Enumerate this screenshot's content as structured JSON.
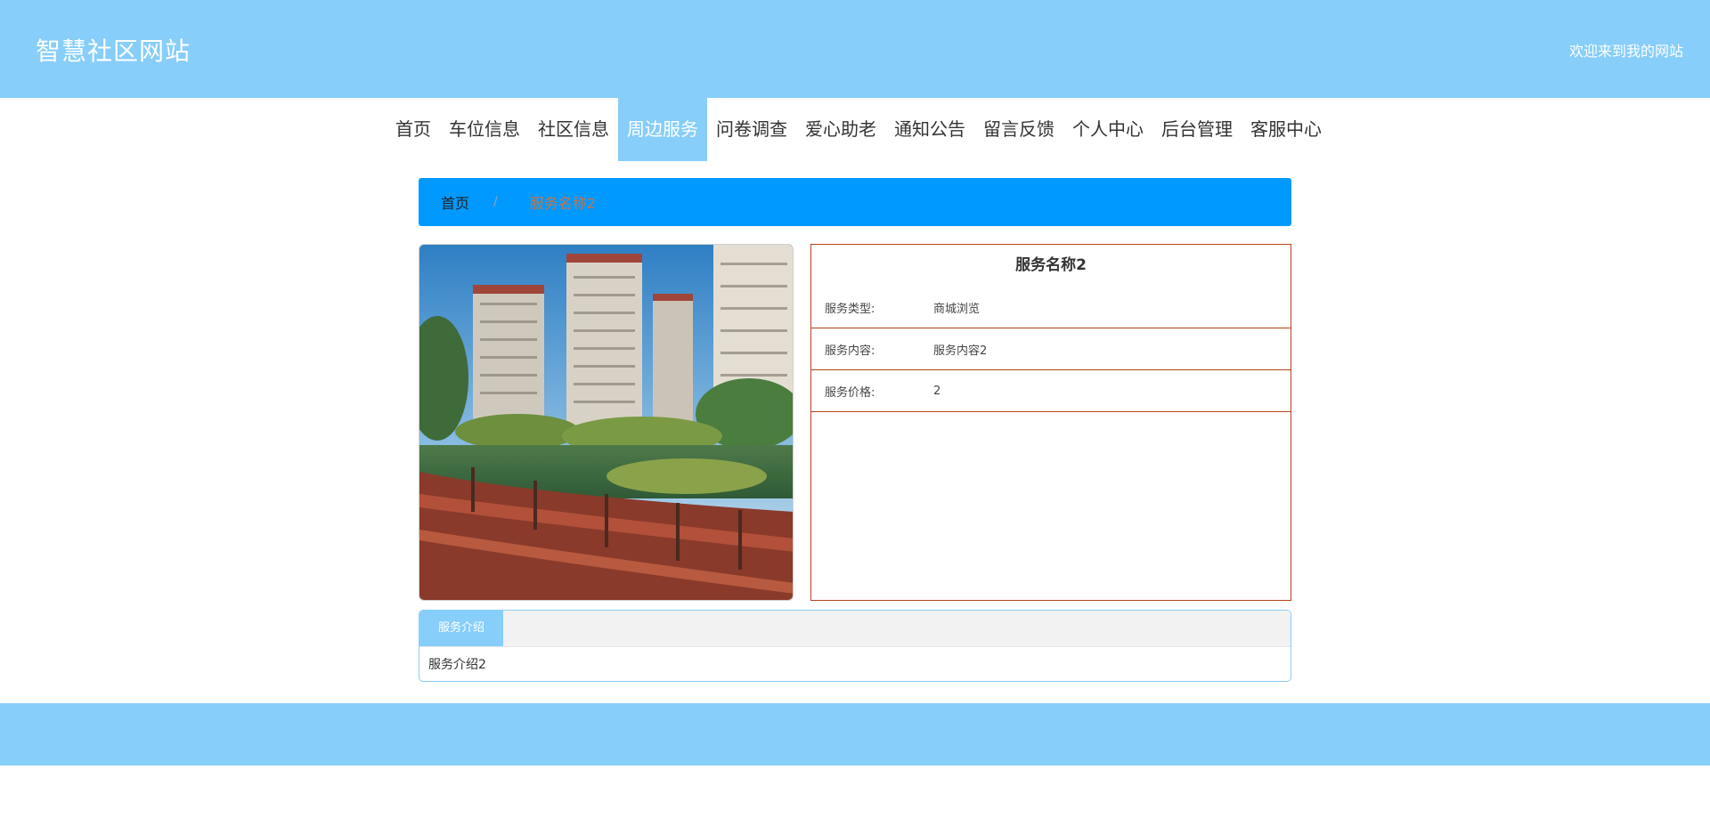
{
  "header": {
    "site_title": "智慧社区网站",
    "welcome": "欢迎来到我的网站"
  },
  "nav": {
    "items": [
      "首页",
      "车位信息",
      "社区信息",
      "周边服务",
      "问卷调查",
      "爱心助老",
      "通知公告",
      "留言反馈",
      "个人中心",
      "后台管理",
      "客服中心"
    ],
    "active": "周边服务"
  },
  "breadcrumb": {
    "home": "首页",
    "separator": "/",
    "current": "服务名称2"
  },
  "detail": {
    "title": "服务名称2",
    "rows": [
      {
        "label": "服务类型:",
        "value": "商城浏览"
      },
      {
        "label": "服务内容:",
        "value": "服务内容2"
      },
      {
        "label": "服务价格:",
        "value": "2"
      }
    ]
  },
  "tabs": {
    "active_label": "服务介绍",
    "content": "服务介绍2"
  },
  "colors": {
    "header_bg": "#87cefa",
    "breadcrumb_bg": "#0099ff",
    "detail_border": "#b5441b",
    "active_nav": "#87cefa"
  }
}
